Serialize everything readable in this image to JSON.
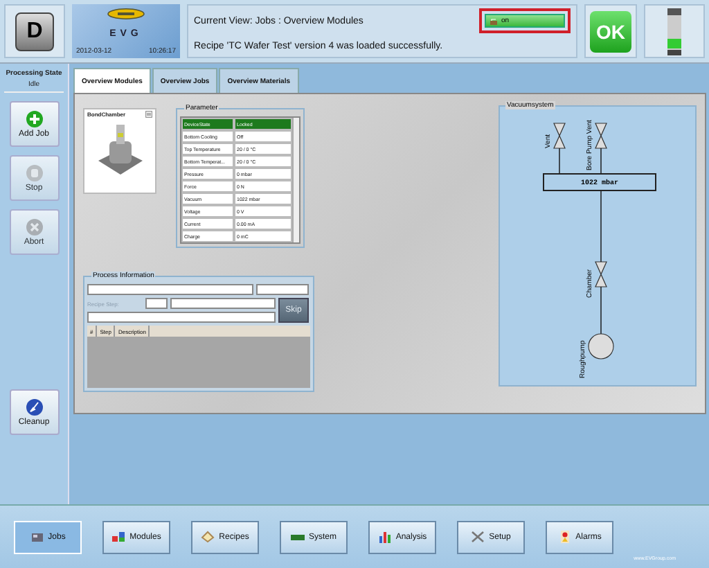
{
  "header": {
    "mode_key": "D",
    "logo": "EVG",
    "date": "2012-03-12",
    "time": "10:26:17",
    "current_view": "Current View: Jobs : Overview Modules",
    "message": "Recipe 'TC Wafer Test' version 4 was loaded successfully.",
    "lock_status": "on",
    "ok_label": "OK"
  },
  "processing_state": {
    "label": "Processing State",
    "value": "Idle"
  },
  "side_buttons": [
    {
      "kind": "add",
      "label": "Add Job",
      "disabled": false
    },
    {
      "kind": "stop",
      "label": "Stop",
      "disabled": true
    },
    {
      "kind": "abort",
      "label": "Abort",
      "disabled": true
    },
    {
      "kind": "cleanup",
      "label": "Cleanup",
      "disabled": false
    }
  ],
  "tabs": [
    {
      "label": "Overview Modules",
      "selected": true
    },
    {
      "label": "Overview Jobs",
      "selected": false
    },
    {
      "label": "Overview Materials",
      "selected": false
    }
  ],
  "module": {
    "name": "BondChamber"
  },
  "parameter": {
    "title": "Parameter",
    "rows": [
      {
        "name": "DeviceState",
        "value": "Locked",
        "selected": true
      },
      {
        "name": "Bottom Cooling",
        "value": "Off",
        "selected": false
      },
      {
        "name": "Top Temperature",
        "value": "20 / 0 °C",
        "selected": false
      },
      {
        "name": "Bottom Temperat...",
        "value": "20 / 0 °C",
        "selected": false
      },
      {
        "name": "Pressure",
        "value": "0 mbar",
        "selected": false
      },
      {
        "name": "Force",
        "value": "0 N",
        "selected": false
      },
      {
        "name": "Vacuum",
        "value": "1022 mbar",
        "selected": false
      },
      {
        "name": "Voltage",
        "value": "0 V",
        "selected": false
      },
      {
        "name": "Current",
        "value": "0.00 mA",
        "selected": false
      },
      {
        "name": "Charge",
        "value": "0 mC",
        "selected": false
      }
    ]
  },
  "process_information": {
    "title": "Process Information",
    "recipe_step_label": "Recipe Step:",
    "skip_label": "Skip",
    "columns": [
      "#",
      "Step",
      "Description"
    ]
  },
  "vacuumsystem": {
    "title": "Vacuumsystem",
    "reading": "1022 mbar",
    "valves": [
      "Vent",
      "Bore Pump Vent",
      "Chamber"
    ],
    "pump": "Roughpump"
  },
  "nav": [
    {
      "kind": "jobs",
      "label": "Jobs",
      "selected": true
    },
    {
      "kind": "modules",
      "label": "Modules",
      "selected": false
    },
    {
      "kind": "recipes",
      "label": "Recipes",
      "selected": false
    },
    {
      "kind": "system",
      "label": "System",
      "selected": false
    },
    {
      "kind": "analysis",
      "label": "Analysis",
      "selected": false
    },
    {
      "kind": "setup",
      "label": "Setup",
      "selected": false
    },
    {
      "kind": "alarms",
      "label": "Alarms",
      "selected": false
    }
  ],
  "footer": {
    "website": "www.EVGroup.com"
  }
}
